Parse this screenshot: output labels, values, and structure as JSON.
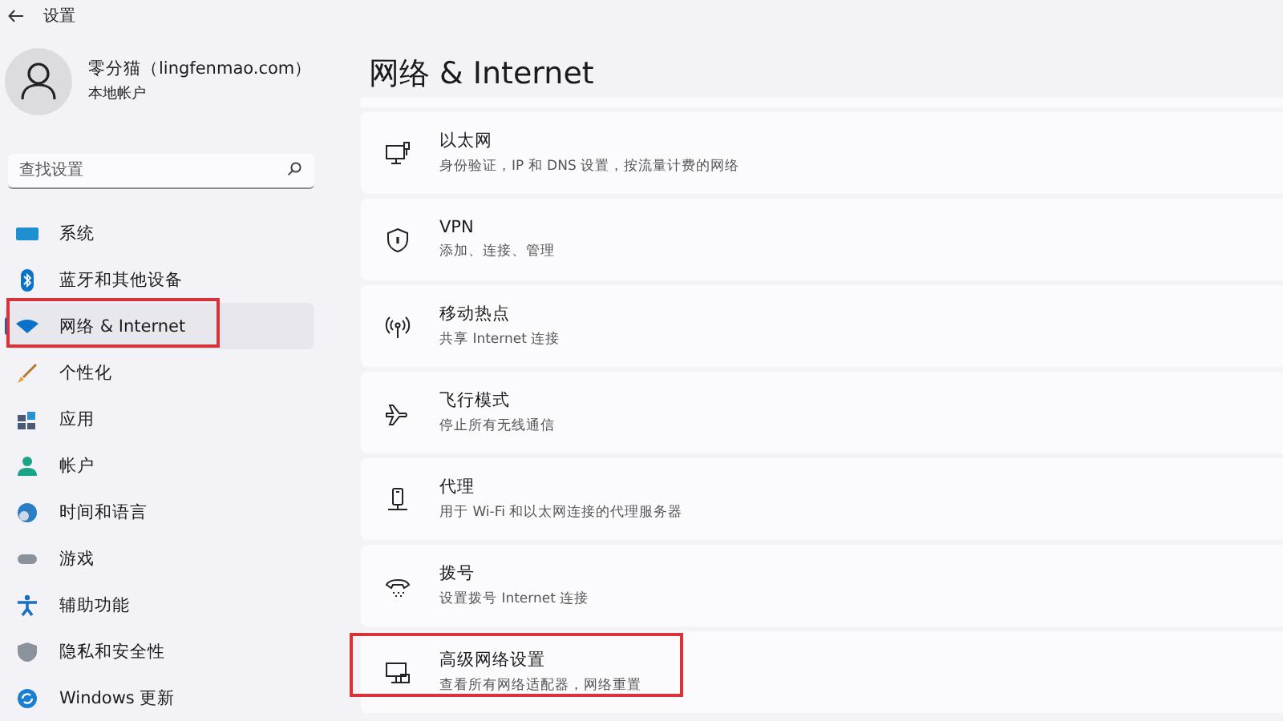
{
  "window": {
    "title": "设置"
  },
  "user": {
    "name": "零分猫（lingfenmao.com）",
    "account_type": "本地帐户"
  },
  "search": {
    "placeholder": "查找设置"
  },
  "sidebar": {
    "items": [
      {
        "label": "系统",
        "selected": false,
        "annotated": false
      },
      {
        "label": "蓝牙和其他设备",
        "selected": false,
        "annotated": false
      },
      {
        "label": "网络 & Internet",
        "selected": true,
        "annotated": true
      },
      {
        "label": "个性化",
        "selected": false,
        "annotated": false
      },
      {
        "label": "应用",
        "selected": false,
        "annotated": false
      },
      {
        "label": "帐户",
        "selected": false,
        "annotated": false
      },
      {
        "label": "时间和语言",
        "selected": false,
        "annotated": false
      },
      {
        "label": "游戏",
        "selected": false,
        "annotated": false
      },
      {
        "label": "辅助功能",
        "selected": false,
        "annotated": false
      },
      {
        "label": "隐私和安全性",
        "selected": false,
        "annotated": false
      },
      {
        "label": "Windows 更新",
        "selected": false,
        "annotated": false
      }
    ]
  },
  "page": {
    "title": "网络 & Internet",
    "cards": [
      {
        "title": "以太网",
        "description": "身份验证，IP 和 DNS 设置，按流量计费的网络",
        "annotated": false
      },
      {
        "title": "VPN",
        "description": "添加、连接、管理",
        "annotated": false
      },
      {
        "title": "移动热点",
        "description": "共享 Internet 连接",
        "annotated": false
      },
      {
        "title": "飞行模式",
        "description": "停止所有无线通信",
        "annotated": false
      },
      {
        "title": "代理",
        "description": "用于 Wi-Fi 和以太网连接的代理服务器",
        "annotated": false
      },
      {
        "title": "拨号",
        "description": "设置拨号 Internet 连接",
        "annotated": false
      },
      {
        "title": "高级网络设置",
        "description": "查看所有网络适配器，网络重置",
        "annotated": true
      }
    ]
  }
}
